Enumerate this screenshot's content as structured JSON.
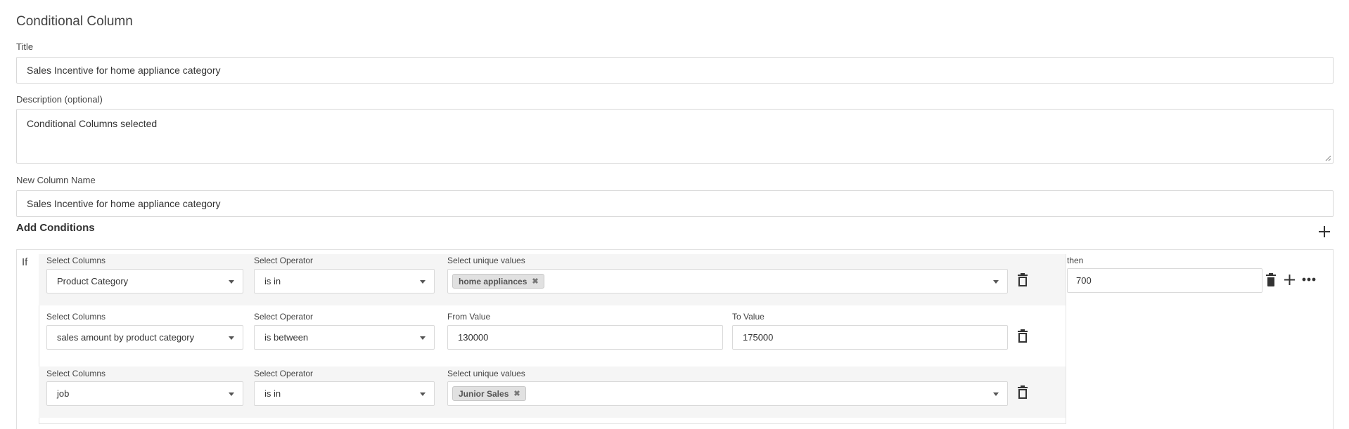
{
  "page": {
    "title": "Conditional Column"
  },
  "form": {
    "title_label": "Title",
    "title_value": "Sales Incentive for home appliance category",
    "description_label": "Description (optional)",
    "description_value": "Conditional Columns selected",
    "new_column_label": "New Column Name",
    "new_column_value": "Sales Incentive for home appliance category"
  },
  "conditions": {
    "section_title": "Add Conditions",
    "if_label": "If",
    "then_label": "then",
    "then_value": "700",
    "rows": [
      {
        "column_label": "Select Columns",
        "column_value": "Product Category",
        "operator_label": "Select Operator",
        "operator_value": "is in",
        "values_label": "Select unique values",
        "tags": [
          "home appliances"
        ]
      },
      {
        "column_label": "Select Columns",
        "column_value": "sales amount by product category",
        "operator_label": "Select Operator",
        "operator_value": "is between",
        "from_label": "From Value",
        "from_value": "130000",
        "to_label": "To Value",
        "to_value": "175000"
      },
      {
        "column_label": "Select Columns",
        "column_value": "job",
        "operator_label": "Select Operator",
        "operator_value": "is in",
        "values_label": "Select unique values",
        "tags": [
          "Junior Sales"
        ]
      }
    ]
  },
  "icons": {
    "add": "plus-icon",
    "delete": "trash-icon",
    "more": "ellipsis-icon",
    "remove_tag": "close-icon",
    "dropdown": "caret-down-icon"
  },
  "colors": {
    "border": "#d9d9d9",
    "row_shade": "#f5f5f5",
    "tag_bg": "#e1e1e1",
    "icon": "#333333"
  }
}
